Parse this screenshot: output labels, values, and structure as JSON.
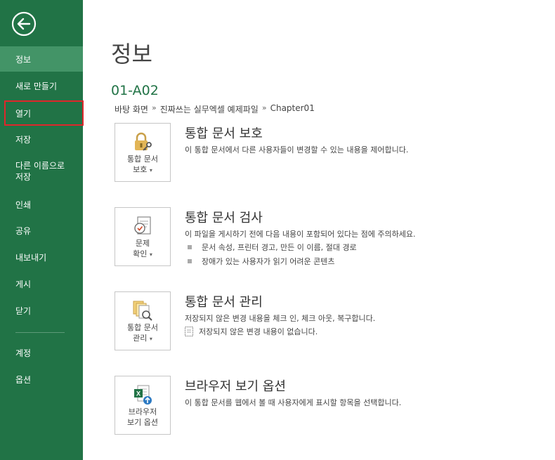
{
  "sidebar": {
    "items": [
      {
        "label": "정보"
      },
      {
        "label": "새로 만들기"
      },
      {
        "label": "열기"
      },
      {
        "label": "저장"
      },
      {
        "label": "다른 이름으로\n저장"
      },
      {
        "label": "인쇄"
      },
      {
        "label": "공유"
      },
      {
        "label": "내보내기"
      },
      {
        "label": "게시"
      },
      {
        "label": "닫기"
      },
      {
        "label": "계정"
      },
      {
        "label": "옵션"
      }
    ]
  },
  "main": {
    "title": "정보",
    "file_name": "01-A02",
    "breadcrumb": [
      "바탕 화면",
      "진짜쓰는 실무엑셀 예제파일",
      "Chapter01"
    ],
    "breadcrumb_sep": "»",
    "sections": [
      {
        "tile_line1": "통합 문서",
        "tile_line2": "보호",
        "title": "통합 문서 보호",
        "desc": "이 통합 문서에서 다른 사용자들이 변경할 수 있는 내용을 제어합니다."
      },
      {
        "tile_line1": "문제",
        "tile_line2": "확인",
        "title": "통합 문서 검사",
        "desc": "이 파일을 게시하기 전에 다음 내용이 포함되어 있다는 점에 주의하세요.",
        "bullets": [
          "문서 속성, 프린터 경고, 만든 이 이름, 절대 경로",
          "장애가 있는 사용자가 읽기 어려운 콘텐츠"
        ]
      },
      {
        "tile_line1": "통합 문서",
        "tile_line2": "관리",
        "title": "통합 문서 관리",
        "desc": "저장되지 않은 변경 내용을 체크 인, 체크 아웃, 복구합니다.",
        "bullets": [
          "저장되지 않은 변경 내용이 없습니다."
        ]
      },
      {
        "tile_line1": "브라우저",
        "tile_line2": "보기 옵션",
        "title": "브라우저 보기 옵션",
        "desc": "이 통합 문서를 웹에서 볼 때 사용자에게 표시할 항목을 선택합니다."
      }
    ]
  },
  "caret": "▾",
  "colors": {
    "sidebar": "#217346",
    "active": "#439467",
    "highlight": "#e0262b",
    "accent": "#217346"
  }
}
